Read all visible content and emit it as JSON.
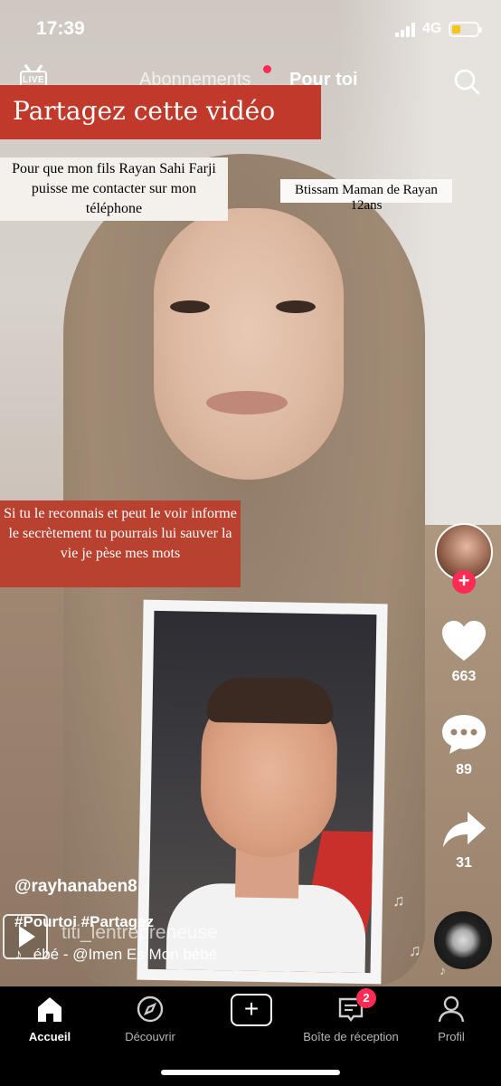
{
  "status_bar": {
    "time": "17:39",
    "network": "4G",
    "battery_level": 0.35
  },
  "top_nav": {
    "live_label": "LIVE",
    "tabs": [
      {
        "label": "Abonnements",
        "active": false
      },
      {
        "label": "Pour toi",
        "active": true
      }
    ]
  },
  "overlays": {
    "banner": "Partagez cette vidéo",
    "note_top_left": "Pour que mon fils Rayan Sahi Farji puisse me contacter sur mon téléphone",
    "note_top_right": "Btissam Maman de Rayan 12ans",
    "note_middle": "Si tu le reconnais et peut le voir informe le secrètement tu pourrais lui sauver la vie je pèse mes mots"
  },
  "right_rail": {
    "likes": "663",
    "comments": "89",
    "shares": "31"
  },
  "caption": {
    "username": "@rayhanaben8",
    "hashtags": "#Pourtoi #Partagez",
    "duet_overlay": "titi_lentrepreneuse",
    "music": "ébé - @Imen Es     Mon bébé"
  },
  "bottom_nav": {
    "items": [
      {
        "label": "Accueil",
        "icon": "home-icon",
        "active": true
      },
      {
        "label": "Découvrir",
        "icon": "compass-icon",
        "active": false
      },
      {
        "label": "",
        "icon": "plus-icon",
        "active": false
      },
      {
        "label": "Boîte de réception",
        "icon": "inbox-icon",
        "active": false
      },
      {
        "label": "Profil",
        "icon": "profile-icon",
        "active": false
      }
    ],
    "inbox_badge": "2"
  },
  "colors": {
    "accent": "#fe2c55",
    "banner_red": "#c0392b",
    "battery": "#f5c518"
  }
}
